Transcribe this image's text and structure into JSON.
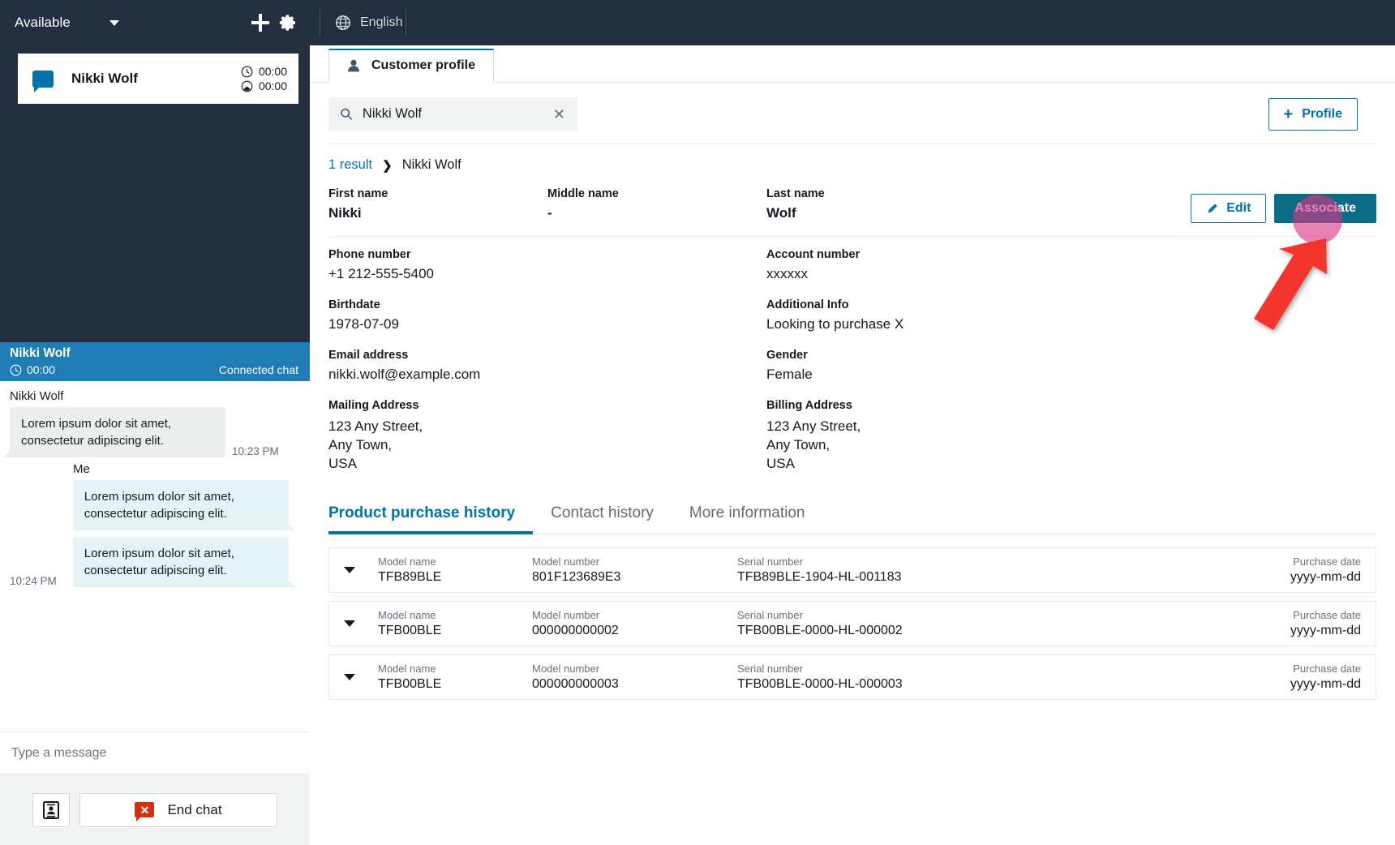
{
  "ccp": {
    "status": "Available",
    "status_chevron_icon": "chevron-down-icon",
    "add_icon": "plus-icon",
    "settings_icon": "gear-icon",
    "contacts": [
      {
        "icon": "chat-bubble-icon",
        "name": "Nikki Wolf",
        "timer_primary": "00:00",
        "timer_secondary": "00:00",
        "timer_primary_icon": "clock-icon",
        "timer_secondary_icon": "moon-clock-icon"
      }
    ],
    "chat": {
      "header_name": "Nikki Wolf",
      "header_timer": "00:00",
      "header_timer_icon": "clock-icon",
      "header_status": "Connected chat",
      "messages": [
        {
          "sender": "Nikki Wolf",
          "direction": "in",
          "text": "Lorem ipsum dolor sit amet, consectetur adipiscing elit.",
          "time": "10:23 PM"
        },
        {
          "sender": "Me",
          "direction": "out",
          "time": "10:24 PM",
          "texts": [
            "Lorem ipsum dolor sit amet, consectetur adipiscing elit.",
            "Lorem ipsum dolor sit amet, consectetur adipiscing elit."
          ]
        }
      ],
      "composer_placeholder": "Type a message",
      "composer_value": "",
      "quick_responses_icon": "contact-card-icon",
      "end_chat_label": "End chat",
      "end_chat_icon": "red-x-bubble-icon"
    },
    "colors": {
      "panel_bg": "#232f3e",
      "chat_header_bg": "#1f7cb4",
      "bubble_in": "#eceded",
      "bubble_out": "#e6f3f4"
    }
  },
  "main": {
    "topbar": {
      "globe_icon": "globe-icon",
      "language": "English"
    },
    "tab": {
      "icon": "person-icon",
      "label": "Customer profile"
    },
    "search": {
      "icon": "search-icon",
      "value": "Nikki Wolf",
      "placeholder": "Search",
      "clear_icon": "close-icon"
    },
    "profile_button": {
      "plus_icon": "plus-icon",
      "label": "Profile"
    },
    "breadcrumb": {
      "result_link": "1 result",
      "separator_icon": "chevron-right-icon",
      "current": "Nikki Wolf"
    },
    "name_fields": [
      {
        "label": "First name",
        "value": "Nikki"
      },
      {
        "label": "Middle name",
        "value": "-"
      },
      {
        "label": "Last name",
        "value": "Wolf"
      }
    ],
    "actions": {
      "edit_label": "Edit",
      "edit_icon": "pencil-icon",
      "associate_label": "Associate"
    },
    "details_left": [
      {
        "label": "Phone number",
        "value": "+1 212-555-5400"
      },
      {
        "label": "Birthdate",
        "value": "1978-07-09"
      },
      {
        "label": "Email address",
        "value": "nikki.wolf@example.com"
      },
      {
        "label": "Mailing Address",
        "value": "123 Any Street,\nAny Town,\nUSA"
      }
    ],
    "details_right": [
      {
        "label": "Account number",
        "value": "xxxxxx"
      },
      {
        "label": "Additional Info",
        "value": "Looking to purchase X"
      },
      {
        "label": "Gender",
        "value": "Female"
      },
      {
        "label": "Billing Address",
        "value": "123 Any Street,\nAny Town,\nUSA"
      }
    ],
    "subtabs": [
      {
        "label": "Product purchase history",
        "active": true
      },
      {
        "label": "Contact history",
        "active": false
      },
      {
        "label": "More information",
        "active": false
      }
    ],
    "purchase_headers": {
      "model_name": "Model name",
      "model_number": "Model number",
      "serial_number": "Serial number",
      "purchase_date": "Purchase date"
    },
    "purchases": [
      {
        "expand_icon": "chevron-down-icon",
        "model_name": "TFB89BLE",
        "model_number": "801F123689E3",
        "serial_number": "TFB89BLE-1904-HL-001183",
        "purchase_date": "yyyy-mm-dd"
      },
      {
        "expand_icon": "chevron-down-icon",
        "model_name": "TFB00BLE",
        "model_number": "000000000002",
        "serial_number": "TFB00BLE-0000-HL-000002",
        "purchase_date": "yyyy-mm-dd"
      },
      {
        "expand_icon": "chevron-down-icon",
        "model_name": "TFB00BLE",
        "model_number": "000000000003",
        "serial_number": "TFB00BLE-0000-HL-000003",
        "purchase_date": "yyyy-mm-dd"
      }
    ],
    "colors": {
      "link": "#0073bb",
      "primary_button": "#0a6e87",
      "accent": "#0073a8",
      "annotation_highlight": "#d63384",
      "annotation_arrow": "#f4352e"
    }
  }
}
